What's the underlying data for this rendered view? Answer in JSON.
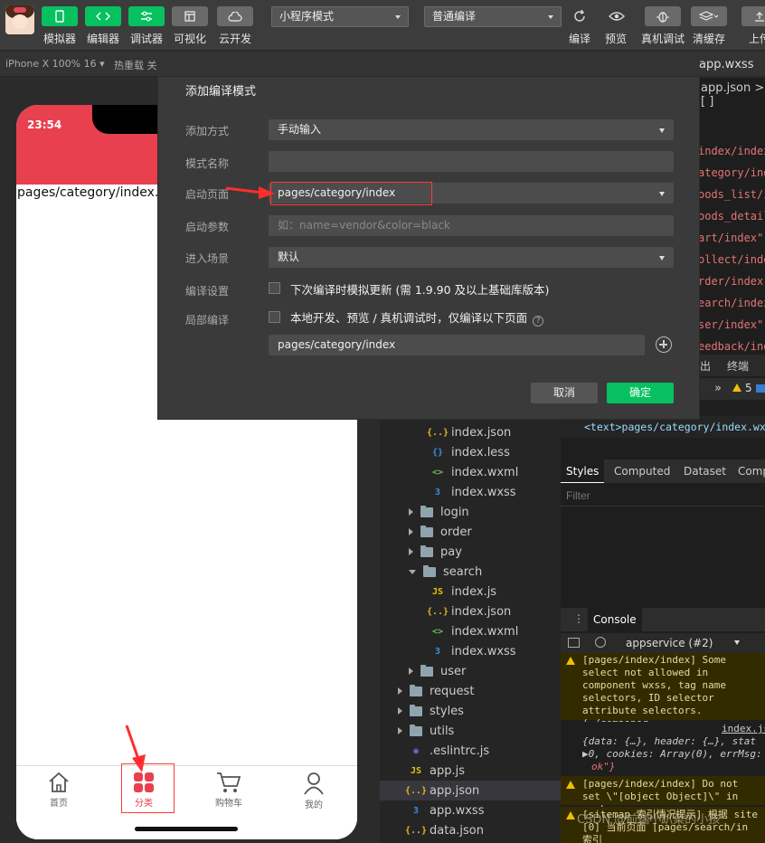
{
  "toolbar": {
    "buttons": [
      {
        "label": "模拟器",
        "icon": "phone-icon"
      },
      {
        "label": "编辑器",
        "icon": "code-icon"
      },
      {
        "label": "调试器",
        "icon": "debug-icon"
      },
      {
        "label": "可视化",
        "icon": "layout-icon"
      },
      {
        "label": "云开发",
        "icon": "cloud-icon"
      }
    ],
    "mode_select": "小程序模式",
    "compile_select": "普通编译",
    "right_buttons": [
      {
        "label": "编译",
        "icon": "refresh-icon"
      },
      {
        "label": "预览",
        "icon": "eye-icon"
      },
      {
        "label": "真机调试",
        "icon": "bug-icon"
      },
      {
        "label": "清缓存",
        "icon": "layers-icon"
      },
      {
        "label": "上传",
        "icon": "upload-icon"
      }
    ]
  },
  "subbar": {
    "device": "iPhone X 100% 16 ▾",
    "hot_reload": "热重载 关"
  },
  "simulator": {
    "time": "23:54",
    "page_text": "pages/category/index.w",
    "tabs": [
      {
        "label": "首页",
        "icon": "home-icon"
      },
      {
        "label": "分类",
        "icon": "category-icon",
        "active": true
      },
      {
        "label": "购物车",
        "icon": "cart-icon"
      },
      {
        "label": "我的",
        "icon": "user-icon"
      }
    ],
    "accent": "#e8404f"
  },
  "modal": {
    "title": "添加编译模式",
    "fields": {
      "add_method": {
        "label": "添加方式",
        "value": "手动输入"
      },
      "mode_name": {
        "label": "模式名称",
        "value": ""
      },
      "start_page": {
        "label": "启动页面",
        "value": "pages/category/index"
      },
      "start_params": {
        "label": "启动参数",
        "placeholder": "如：name=vendor&color=black"
      },
      "scene": {
        "label": "进入场景",
        "value": "默认"
      },
      "compile_settings": {
        "label": "编译设置",
        "checkbox_text": "下次编译时模拟更新 (需 1.9.90 及以上基础库版本)"
      },
      "partial_compile": {
        "label": "局部编译",
        "checkbox_text": "本地开发、预览 / 真机调试时，仅编译以下页面",
        "help": "?",
        "page": "pages/category/index"
      }
    },
    "cancel": "取消",
    "confirm": "确定"
  },
  "editor_tabs": {
    "file_tab": "app.wxss",
    "breadcrumb": "app.json > [ ]"
  },
  "code_lines": [
    "index/index\",",
    "ategory/index",
    "oods_list/in",
    "oods_detail/",
    "art/index\",",
    "ollect/index",
    "rder/index\",",
    "earch/index\"",
    "ser/index\",",
    "eedback/inde"
  ],
  "tree": [
    {
      "name": "index.json",
      "type": "json",
      "indent": 2
    },
    {
      "name": "index.less",
      "type": "less",
      "indent": 2
    },
    {
      "name": "index.wxml",
      "type": "wxml",
      "indent": 2
    },
    {
      "name": "index.wxss",
      "type": "wxss",
      "indent": 2
    },
    {
      "name": "login",
      "type": "folder",
      "indent": 1
    },
    {
      "name": "order",
      "type": "folder",
      "indent": 1
    },
    {
      "name": "pay",
      "type": "folder",
      "indent": 1
    },
    {
      "name": "search",
      "type": "folder-open",
      "indent": 1
    },
    {
      "name": "index.js",
      "type": "js",
      "indent": 2
    },
    {
      "name": "index.json",
      "type": "json",
      "indent": 2
    },
    {
      "name": "index.wxml",
      "type": "wxml",
      "indent": 2
    },
    {
      "name": "index.wxss",
      "type": "wxss",
      "indent": 2
    },
    {
      "name": "user",
      "type": "folder",
      "indent": 1
    },
    {
      "name": "request",
      "type": "folder",
      "indent": 0
    },
    {
      "name": "styles",
      "type": "folder",
      "indent": 0
    },
    {
      "name": "utils",
      "type": "folder",
      "indent": 0
    },
    {
      "name": ".eslintrc.js",
      "type": "eslint",
      "indent": 0
    },
    {
      "name": "app.js",
      "type": "js",
      "indent": 0
    },
    {
      "name": "app.json",
      "type": "json",
      "indent": 0,
      "selected": true
    },
    {
      "name": "app.wxss",
      "type": "wxss",
      "indent": 0
    },
    {
      "name": "data.json",
      "type": "json",
      "indent": 0
    }
  ],
  "devtools": {
    "panel_tabs": [
      "出",
      "终端"
    ],
    "warn_count": "5",
    "dom_text": "<text>pages/category/index.wxml",
    "style_tabs": [
      "Styles",
      "Computed",
      "Dataset",
      "Comp"
    ],
    "filter_placeholder": "Filter",
    "console_tab": "Console",
    "context": "appservice (#2)",
    "messages": [
      "[pages/index/index] Some select not allowed in component wxss, tag name selectors, ID selector attribute selectors.(./componer nput/SearchInput.wxss:6:15)",
      "index.js",
      "{data: {…}, header: {…}, stat",
      "▶0, cookies: Array(0), errMsg:",
      "ok\"}",
      "[pages/index/index] Do not set \\\"[object Object]\\\" in wx:key.",
      "[sitemap 索引情况提示] 根据 site [0] 当前页面 [pages/search/in 索引"
    ]
  },
  "watermark": "CSDN @前端小趴菜的小孩"
}
